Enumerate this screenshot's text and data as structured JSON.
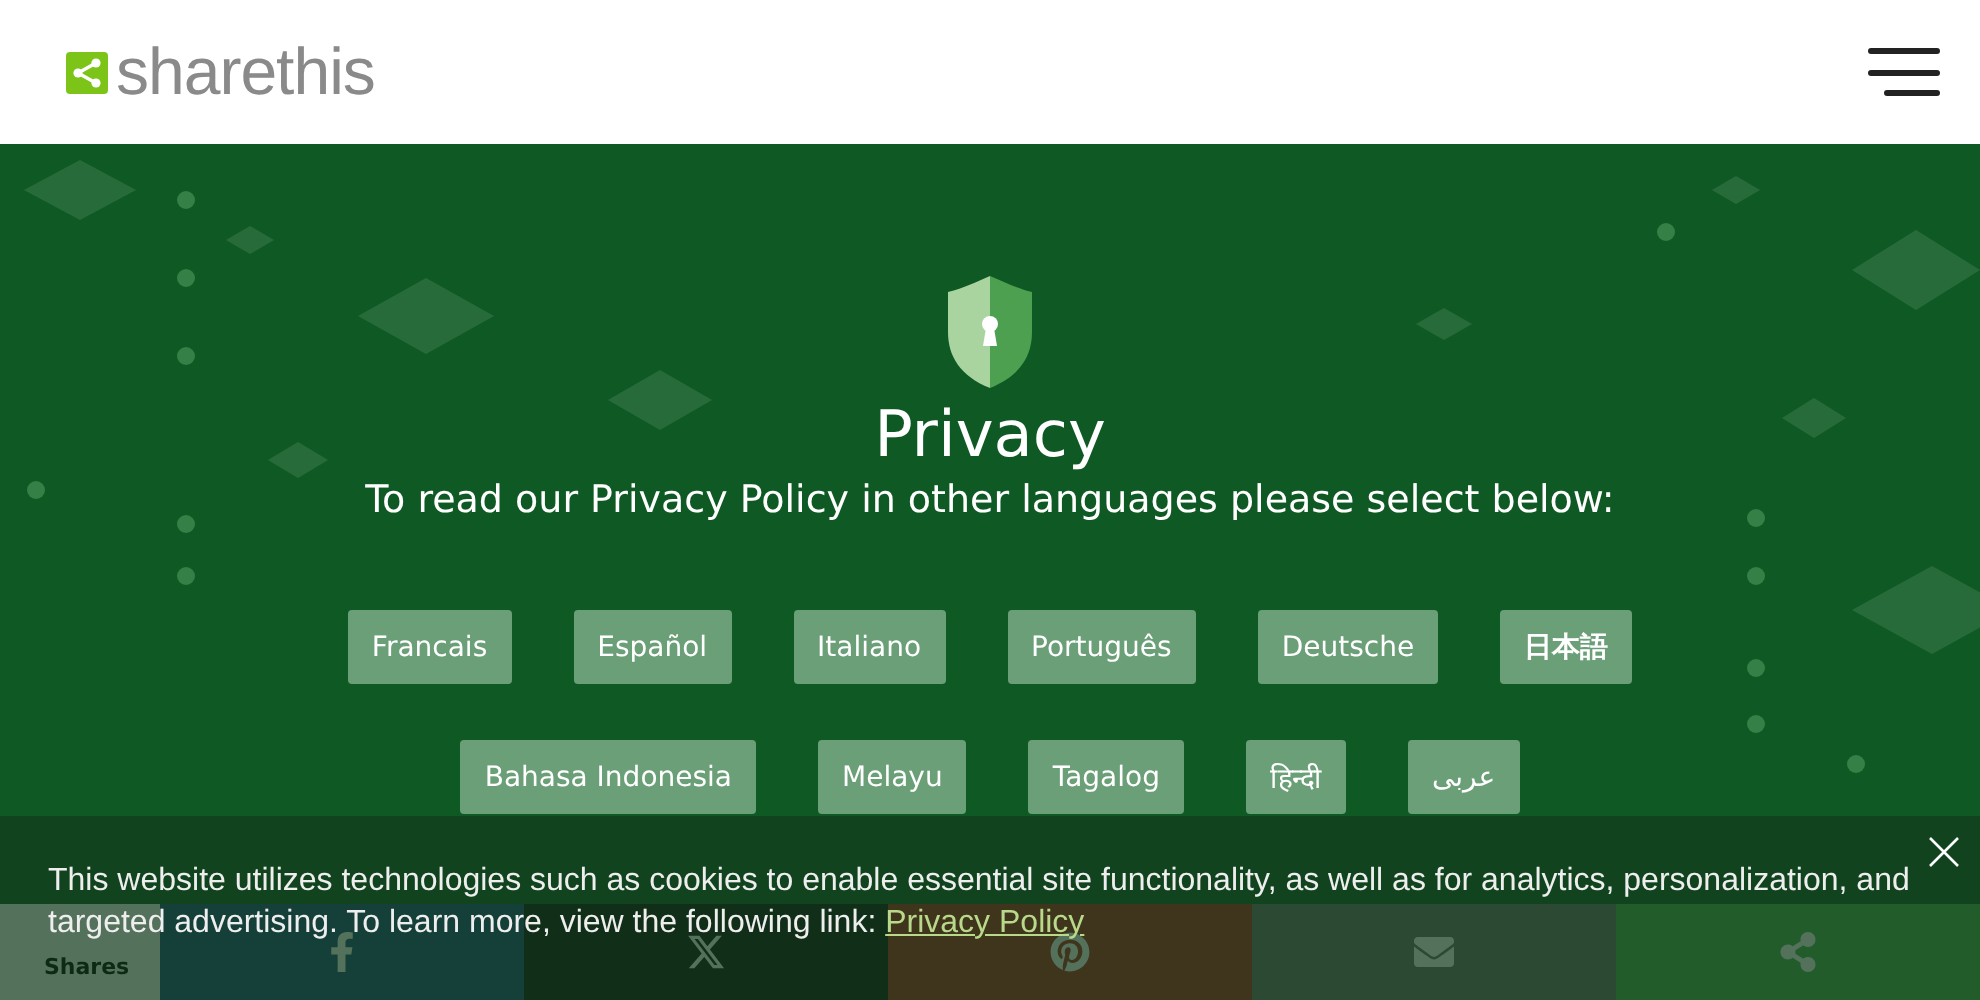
{
  "header": {
    "logo": "sharethis"
  },
  "hero": {
    "title": "Privacy",
    "subtitle": "To read our Privacy Policy in other languages please select below:"
  },
  "languages": [
    [
      "Francais",
      "Español",
      "Italiano",
      "Português",
      "Deutsche",
      "日本語"
    ],
    [
      "Bahasa Indonesia",
      "Melayu",
      "Tagalog",
      "हिन्दी",
      "عربى"
    ]
  ],
  "share_bar": {
    "count_label": "Shares",
    "buttons": [
      {
        "kind": "facebook"
      },
      {
        "kind": "x"
      },
      {
        "kind": "pinterest"
      },
      {
        "kind": "email"
      },
      {
        "kind": "share"
      }
    ]
  },
  "cookie_banner": {
    "text": "This website utilizes technologies such as cookies to enable essential site functionality, as well as for analytics, personalization, and targeted advertising. To learn more, view the following link: ",
    "link": "Privacy Policy"
  }
}
